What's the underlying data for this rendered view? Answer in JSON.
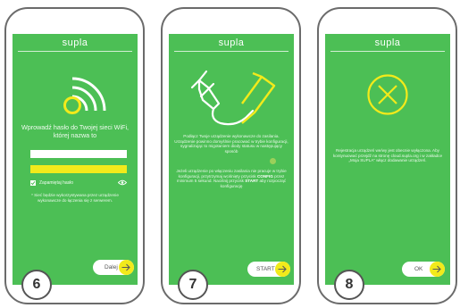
{
  "app": {
    "logo": "supla"
  },
  "screens": [
    {
      "step": "6",
      "title": "Wprowadź hasło do Twojej sieci WiFi, której nazwa to",
      "ssid_value": "",
      "password_value": "",
      "show_password_label": "Zapamiętaj hasło",
      "note": "* Sieć będzie wykorzystywana przez urządzenie wykonawcze do łączenia się z serwerem.",
      "button": "Dalej"
    },
    {
      "step": "7",
      "para1": "Podłącz Twoje urządzenie wykonawcze do zasilania. Urządzenie powinno domyślnie pracować w trybie konfiguracji, sygnalizując to migotaniem diody statusu w następujący sposób",
      "para2_a": "Jeżeli urządzenie po włączeniu zasilania nie pracuje w trybie konfiguracji, przytrzymaj wciśnięty przycisk",
      "para2_key": "CONFIG",
      "para2_b": "przez minimum 5 sekund.",
      "para2_c": "Naciśnij przycisk",
      "para2_start": "START",
      "para2_d": "aby rozpocząć konfigurację",
      "button": "START"
    },
    {
      "step": "8",
      "message": "Rejestracja urządzeń we/wy jest obecnie wyłączona. Aby kontynuować przejdź na stronę cloud.supla.org i w zakładce „Moja SUPLA” włącz dodawanie urządzeń.",
      "button": "OK"
    }
  ],
  "colors": {
    "screen_bg": "#4cbf55",
    "accent": "#f2ea1b",
    "frame": "#6b6b6b"
  }
}
